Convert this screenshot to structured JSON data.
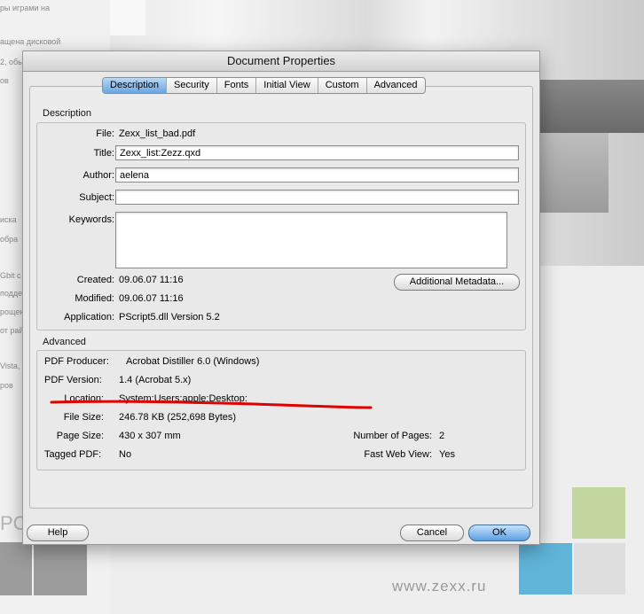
{
  "background": {
    "snippets": [
      "ры играми на",
      "ащена дисковой",
      "2, обы",
      "ов",
      "иска",
      "обра",
      "Gbit с",
      "подде",
      "рощен",
      "от рай",
      "Vista,",
      "ров"
    ],
    "url": "www.zexx.ru",
    "letter": "PC"
  },
  "dialog": {
    "title": "Document Properties",
    "tabs": [
      {
        "label": "Description",
        "active": true
      },
      {
        "label": "Security",
        "active": false
      },
      {
        "label": "Fonts",
        "active": false
      },
      {
        "label": "Initial View",
        "active": false
      },
      {
        "label": "Custom",
        "active": false
      },
      {
        "label": "Advanced",
        "active": false
      }
    ],
    "description": {
      "heading": "Description",
      "file_label": "File:",
      "file_value": "Zexx_list_bad.pdf",
      "title_label": "Title:",
      "title_value": "Zexx_list:Zezz.qxd",
      "author_label": "Author:",
      "author_value": "aelena",
      "subject_label": "Subject:",
      "subject_value": "",
      "keywords_label": "Keywords:",
      "keywords_value": "",
      "created_label": "Created:",
      "created_value": "09.06.07 11:16",
      "modified_label": "Modified:",
      "modified_value": "09.06.07 11:16",
      "application_label": "Application:",
      "application_value": "PScript5.dll Version 5.2",
      "metadata_button": "Additional Metadata..."
    },
    "advanced": {
      "heading": "Advanced",
      "producer_label": "PDF Producer:",
      "producer_value": "Acrobat Distiller 6.0 (Windows)",
      "version_label": "PDF Version:",
      "version_value": "1.4 (Acrobat 5.x)",
      "location_label": "Location:",
      "location_value": "System:Users:apple:Desktop:",
      "filesize_label": "File Size:",
      "filesize_value": "246.78 KB (252,698 Bytes)",
      "pagesize_label": "Page Size:",
      "pagesize_value": "430 x 307 mm",
      "tagged_label": "Tagged PDF:",
      "tagged_value": "No",
      "pages_label": "Number of Pages:",
      "pages_value": "2",
      "fastweb_label": "Fast Web View:",
      "fastweb_value": "Yes"
    },
    "buttons": {
      "help": "Help",
      "cancel": "Cancel",
      "ok": "OK"
    }
  },
  "colors": {
    "annotation_underline": "#e00000",
    "square_green": "#c3d6a0",
    "square_blue": "#5fb4d8",
    "square_light": "#dedede",
    "square_gray": "#9b9b9b"
  }
}
